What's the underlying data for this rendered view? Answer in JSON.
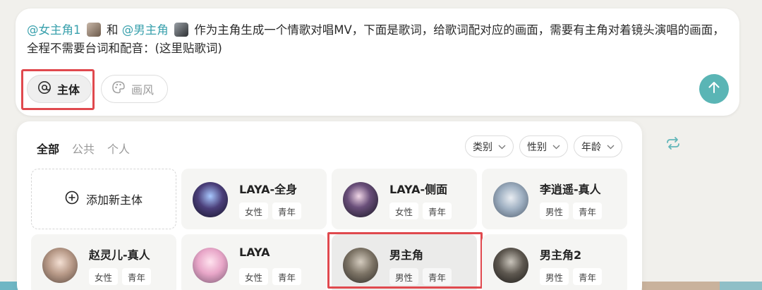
{
  "prompt": {
    "mention_female": "@女主角1",
    "connector": "和",
    "mention_male": "@男主角",
    "body": "作为主角生成一个情歌对唱MV，下面是歌词，给歌词配对应的画面，需要有主角对着镜头演唱的画面，全程不需要台词和配音：(这里贴歌词)"
  },
  "toolbar": {
    "subject_label": "主体",
    "style_label": "画风",
    "send_icon": "arrow-up-icon"
  },
  "panel": {
    "tabs": [
      {
        "label": "全部",
        "active": true
      },
      {
        "label": "公共",
        "active": false
      },
      {
        "label": "个人",
        "active": false
      }
    ],
    "filters": [
      {
        "label": "类别"
      },
      {
        "label": "性别"
      },
      {
        "label": "年龄"
      }
    ],
    "add_label": "添加新主体",
    "characters": [
      {
        "name": "LAYA-全身",
        "gender": "女性",
        "age": "青年"
      },
      {
        "name": "LAYA-侧面",
        "gender": "女性",
        "age": "青年"
      },
      {
        "name": "李逍遥-真人",
        "gender": "男性",
        "age": "青年"
      },
      {
        "name": "赵灵儿-真人",
        "gender": "女性",
        "age": "青年"
      },
      {
        "name": "LAYA",
        "gender": "女性",
        "age": "青年"
      },
      {
        "name": "男主角",
        "gender": "男性",
        "age": "青年"
      },
      {
        "name": "男主角2",
        "gender": "男性",
        "age": "青年"
      }
    ]
  },
  "colors": {
    "accent": "#3aa1ad",
    "send": "#5ab5b5",
    "highlight": "#e0494e"
  }
}
